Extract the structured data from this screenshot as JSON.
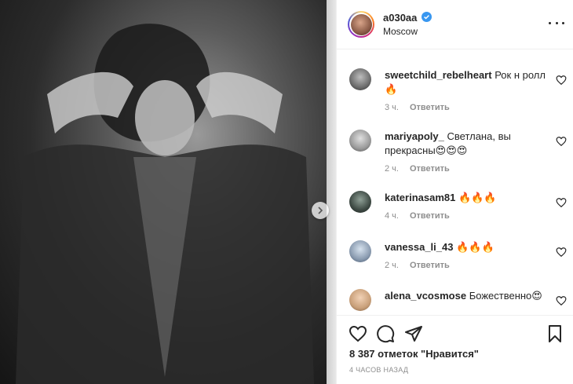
{
  "post": {
    "next_icon": "chevron-right-icon"
  },
  "header": {
    "username": "a030aa",
    "location": "Moscow",
    "verified_icon": "verified-badge-icon",
    "more_icon": "more-options-icon"
  },
  "comments": [
    {
      "user": "sweetchild_rebelheart",
      "text": "Рок н ролл 🔥",
      "age": "3 ч.",
      "reply": "Ответить",
      "avatar_color": "#6d6d6d"
    },
    {
      "user": "mariyapoly_",
      "text": "Светлана, вы прекрасны😍😍😍",
      "age": "2 ч.",
      "reply": "Ответить",
      "avatar_color": "#9a9a9a"
    },
    {
      "user": "katerinasam81",
      "text": "🔥🔥🔥",
      "age": "4 ч.",
      "reply": "Ответить",
      "avatar_color": "#3e4a44"
    },
    {
      "user": "vanessa_li_43",
      "text": "🔥🔥🔥",
      "age": "2 ч.",
      "reply": "Ответить",
      "avatar_color": "#8a9bb0"
    },
    {
      "user": "alena_vcosmose",
      "text": "Божественно😍",
      "age": "",
      "reply": "",
      "avatar_color": "#c9a07a"
    }
  ],
  "actions": {
    "like_icon": "heart-icon",
    "comment_icon": "comment-icon",
    "share_icon": "share-icon",
    "save_icon": "bookmark-icon",
    "likes_text": "8 387 отметок \"Нравится\"",
    "posted_time": "4 ЧАСОВ НАЗАД"
  },
  "colors": {
    "verified_blue": "#3897f0",
    "secondary_text": "#8e8e8e",
    "primary_text": "#262626"
  }
}
